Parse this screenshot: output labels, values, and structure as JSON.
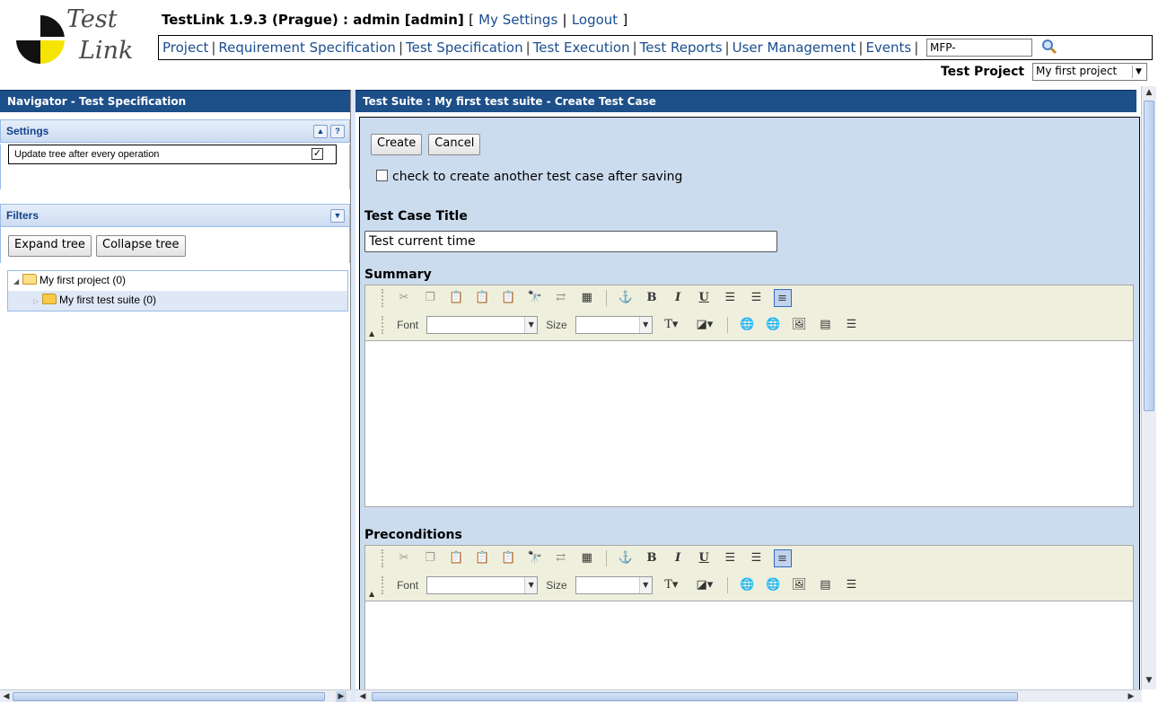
{
  "header": {
    "logo_text_1": "Test",
    "logo_text_2": "Link",
    "title": "TestLink 1.9.3 (Prague) : admin [admin]",
    "bracket_open": "[",
    "my_settings": "My Settings",
    "sep": "|",
    "logout": "Logout",
    "bracket_close": "]",
    "menu": [
      "Project",
      "Requirement Specification",
      "Test Specification",
      "Test Execution",
      "Test Reports",
      "User Management",
      "Events"
    ],
    "search_value": "MFP-",
    "project_label": "Test Project",
    "project_selected": "My first project"
  },
  "left": {
    "pane_title": "Navigator - Test Specification",
    "settings_title": "Settings",
    "settings_option": "Update tree after every operation",
    "settings_checked": true,
    "filters_title": "Filters",
    "expand_tree": "Expand tree",
    "collapse_tree": "Collapse tree",
    "tree": [
      {
        "label": "My first project (0)"
      },
      {
        "label": "My first test suite (0)"
      }
    ]
  },
  "right": {
    "pane_title": "Test Suite : My first test suite - Create Test Case",
    "create": "Create",
    "cancel": "Cancel",
    "another_label": "check to create another test case after saving",
    "test_case_title_label": "Test Case Title",
    "test_case_title_value": "Test current time",
    "summary_label": "Summary",
    "preconditions_label": "Preconditions",
    "font_label": "Font",
    "size_label": "Size"
  },
  "icons": {
    "cut": "cut-icon",
    "copy": "copy-icon",
    "paste": "paste-icon",
    "find": "find-icon"
  },
  "colors": {
    "title_bar": "#1d4f89",
    "panel_bg": "#ccdcef",
    "link": "#1a4e8f"
  }
}
